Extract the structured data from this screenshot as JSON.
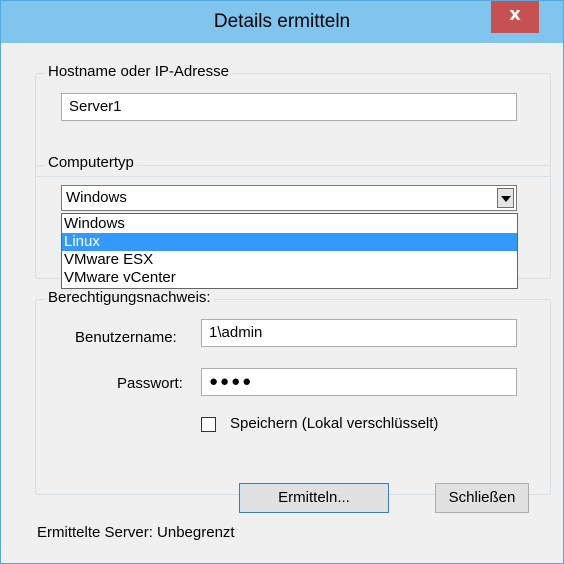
{
  "window": {
    "title": "Details ermitteln",
    "close_symbol": "x"
  },
  "host_group": {
    "legend": "Hostname oder IP-Adresse",
    "value": "Server1"
  },
  "type_group": {
    "legend": "Computertyp",
    "selected": "Windows",
    "options": [
      "Windows",
      "Linux",
      "VMware ESX",
      "VMware vCenter"
    ],
    "highlighted_index": 1
  },
  "cred_group": {
    "legend": "Berechtigungsnachweis:",
    "username_label": "Benutzername:",
    "username_value": "1\\admin",
    "password_label": "Passwort:",
    "password_value": "●●●●",
    "save_label": "Speichern (Lokal verschlüsselt)",
    "save_checked": false
  },
  "buttons": {
    "detect_label": "Ermitteln...",
    "close_label": "Schließen"
  },
  "status": {
    "text": "Ermittelte Server: Unbegrenzt"
  },
  "colors": {
    "titlebar": "#7fc5ee",
    "close": "#c75050",
    "highlight": "#3399ff",
    "border": "#55a9dc"
  }
}
